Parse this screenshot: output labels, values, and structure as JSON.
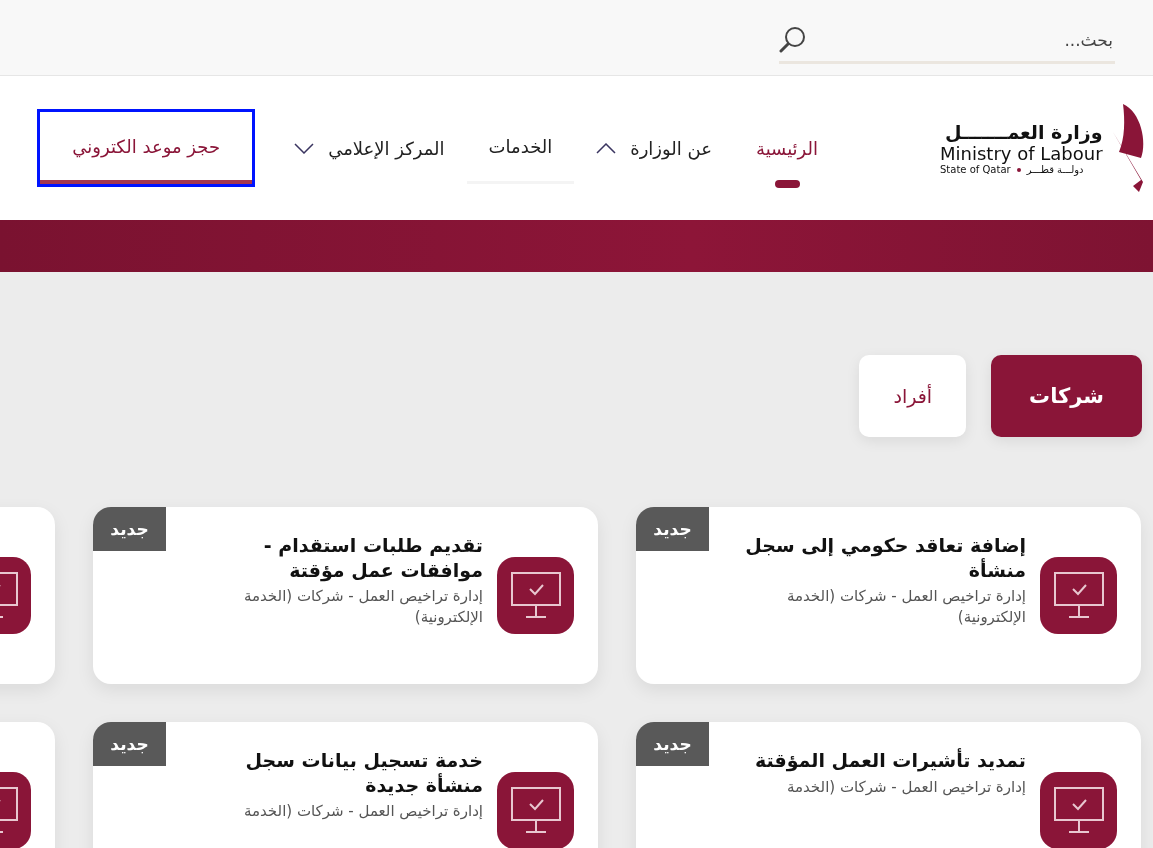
{
  "search": {
    "placeholder": "بحث..."
  },
  "logo": {
    "arabic_name": "وزارة العمـــــــل",
    "english_name": "Ministry of Labour",
    "country_english": "State of Qatar",
    "country_arabic": "دولـــة قطـــر"
  },
  "nav": [
    {
      "label": "الرئيسية",
      "kind": "link",
      "selected": true,
      "highlighted": false
    },
    {
      "label": "عن الوزارة",
      "kind": "menu",
      "selected": false,
      "highlighted": false,
      "expanded": true
    },
    {
      "label": "الخدمات",
      "kind": "link",
      "selected": false,
      "highlighted": true
    },
    {
      "label": "المركز الإعلامي",
      "kind": "menu",
      "selected": false,
      "highlighted": false,
      "expanded": false
    },
    {
      "label": "حجز موعد الكتروني",
      "kind": "cta",
      "selected": false,
      "highlighted": false,
      "focused": true
    }
  ],
  "segments": [
    {
      "label": "شركات",
      "selected": true
    },
    {
      "label": "أفراد",
      "selected": false
    }
  ],
  "cards": [
    {
      "kind": "service",
      "badge": "جديد",
      "title": "إضافة تعاقد حكومي إلى سجل منشأة",
      "subtitle": "إدارة تراخيص العمل - شركات (الخدمة الإلكترونية)"
    },
    {
      "kind": "service",
      "badge": "جديد",
      "title": "تقديم طلبات استقدام - موافقات عمل مؤقتة",
      "subtitle": "إدارة تراخيص العمل - شركات (الخدمة الإلكترونية)"
    },
    {
      "kind": "cut"
    },
    {
      "kind": "service",
      "badge": "جديد",
      "title": "تمديد تأشيرات العمل المؤقتة",
      "subtitle": "إدارة تراخيص العمل - شركات (الخدمة"
    },
    {
      "kind": "service",
      "badge": "جديد",
      "title": "خدمة تسجيل بيانات سجل منشأة جديدة",
      "subtitle": "إدارة تراخيص العمل - شركات (الخدمة"
    },
    {
      "kind": "cut"
    }
  ]
}
